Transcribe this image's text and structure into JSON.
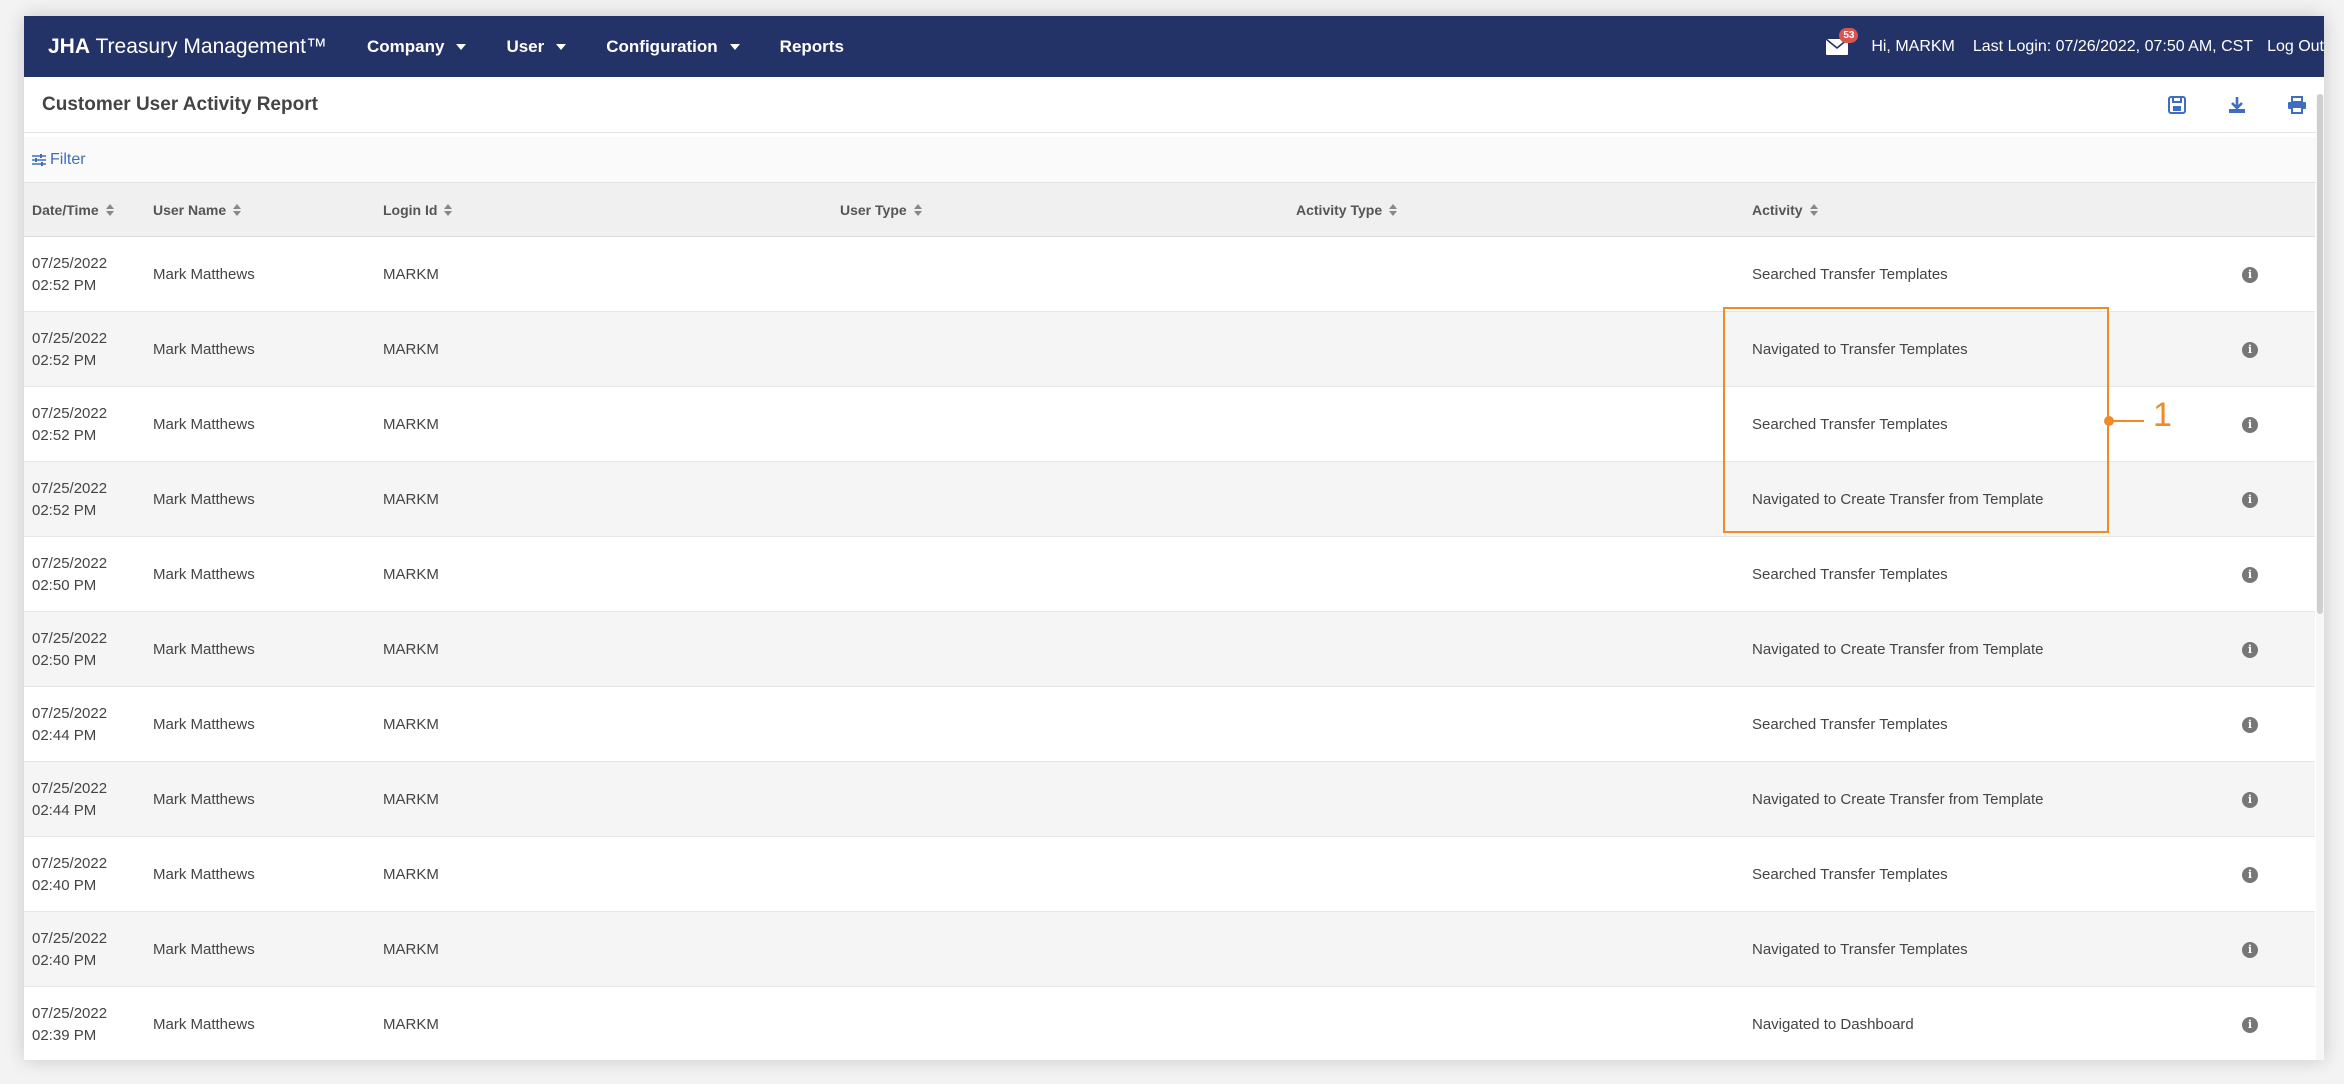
{
  "navbar": {
    "brand_bold": "JHA",
    "brand_rest": "Treasury Management™",
    "menu": [
      {
        "label": "Company"
      },
      {
        "label": "User"
      },
      {
        "label": "Configuration"
      },
      {
        "label": "Reports"
      }
    ],
    "mail_badge": "53",
    "greeting": "Hi, MARKM",
    "last_login": "Last Login: 07/26/2022, 07:50 AM, CST",
    "logout": "Log Out"
  },
  "page": {
    "title": "Customer User Activity Report",
    "icons": [
      "save-icon",
      "download-icon",
      "print-icon"
    ]
  },
  "filter": {
    "label": "Filter"
  },
  "table": {
    "columns": [
      {
        "label": "Date/Time"
      },
      {
        "label": "User Name"
      },
      {
        "label": "Login Id"
      },
      {
        "label": "User Type"
      },
      {
        "label": "Activity Type"
      },
      {
        "label": "Activity"
      }
    ],
    "rows": [
      {
        "date": "07/25/2022",
        "time": "02:52 PM",
        "user": "Mark Matthews",
        "login": "MARKM",
        "activity": "Searched Transfer Templates"
      },
      {
        "date": "07/25/2022",
        "time": "02:52 PM",
        "user": "Mark Matthews",
        "login": "MARKM",
        "activity": "Navigated to Transfer Templates"
      },
      {
        "date": "07/25/2022",
        "time": "02:52 PM",
        "user": "Mark Matthews",
        "login": "MARKM",
        "activity": "Searched Transfer Templates"
      },
      {
        "date": "07/25/2022",
        "time": "02:52 PM",
        "user": "Mark Matthews",
        "login": "MARKM",
        "activity": "Navigated to Create Transfer from Template"
      },
      {
        "date": "07/25/2022",
        "time": "02:50 PM",
        "user": "Mark Matthews",
        "login": "MARKM",
        "activity": "Searched Transfer Templates"
      },
      {
        "date": "07/25/2022",
        "time": "02:50 PM",
        "user": "Mark Matthews",
        "login": "MARKM",
        "activity": "Navigated to Create Transfer from Template"
      },
      {
        "date": "07/25/2022",
        "time": "02:44 PM",
        "user": "Mark Matthews",
        "login": "MARKM",
        "activity": "Searched Transfer Templates"
      },
      {
        "date": "07/25/2022",
        "time": "02:44 PM",
        "user": "Mark Matthews",
        "login": "MARKM",
        "activity": "Navigated to Create Transfer from Template"
      },
      {
        "date": "07/25/2022",
        "time": "02:40 PM",
        "user": "Mark Matthews",
        "login": "MARKM",
        "activity": "Searched Transfer Templates"
      },
      {
        "date": "07/25/2022",
        "time": "02:40 PM",
        "user": "Mark Matthews",
        "login": "MARKM",
        "activity": "Navigated to Transfer Templates"
      },
      {
        "date": "07/25/2022",
        "time": "02:39 PM",
        "user": "Mark Matthews",
        "login": "MARKM",
        "activity": "Navigated to Dashboard"
      }
    ]
  },
  "callout": {
    "number": "1",
    "color": "#f08a24"
  },
  "colors": {
    "navbar": "#233267",
    "link": "#3f6ec0"
  }
}
